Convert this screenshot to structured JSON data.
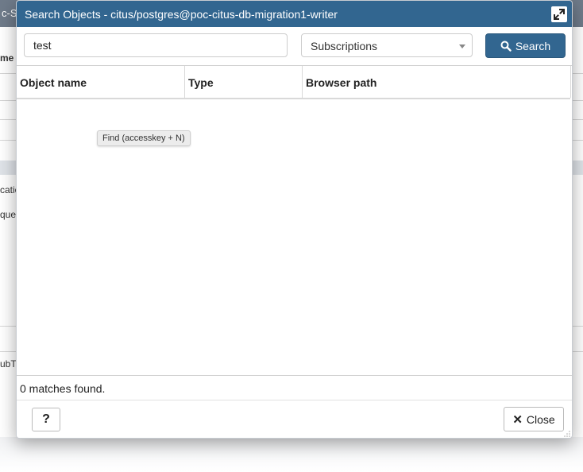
{
  "background": {
    "topbar_text": "c-St",
    "frag_1": "me",
    "frag_2": "catio",
    "frag_3": "que",
    "frag_4": "ubT"
  },
  "dialog": {
    "title": "Search Objects - citus/postgres@poc-citus-db-migration1-writer",
    "search_value": "test",
    "type_filter": "Subscriptions",
    "search_button_label": "Search",
    "columns": [
      "Object name",
      "Type",
      "Browser path"
    ],
    "tooltip": "Find (accesskey + N)",
    "status": "0 matches found.",
    "help_label": "?",
    "close_label": "Close"
  },
  "icons": {
    "expand": "expand-icon",
    "search": "search-icon",
    "close": "close-x-icon",
    "resize": "resize-grip-icon"
  },
  "colors": {
    "titlebar": "#326690",
    "primary_button": "#326690"
  }
}
